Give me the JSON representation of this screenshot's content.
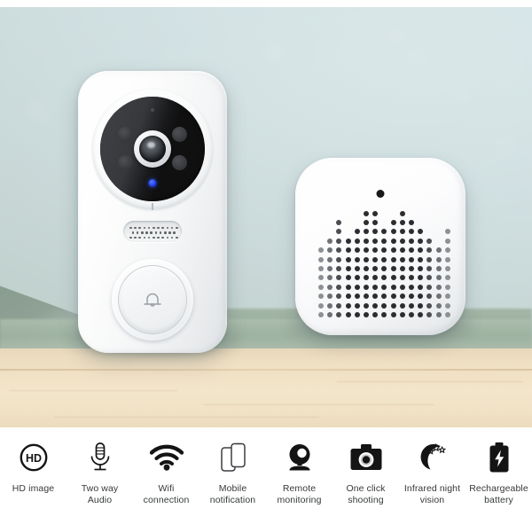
{
  "product": {
    "scene": {
      "wall_color": "#d3e1e4",
      "wall_shadow_color": "#8b9d90",
      "table_color": "#f1e2c6",
      "table_green_band": "#9fb3a1"
    },
    "doorbell": {
      "name": "Smart Video Doorbell",
      "body_color": "#ffffff",
      "camera_face_color": "#131314",
      "ir_led_count": 4,
      "status_led_color": "#2040e8",
      "button_icon": "bell-icon",
      "grille_rows": 3,
      "grille_cols": 11
    },
    "chime": {
      "name": "Wireless Chime Receiver",
      "body_color": "#ffffff",
      "led_color": "#18191b",
      "grille_pattern": "equalizer-dot-matrix",
      "grille_cols": 15,
      "grille_rows": 12,
      "grille_heights": [
        8,
        9,
        11,
        9,
        10,
        12,
        12,
        10,
        11,
        12,
        11,
        10,
        9,
        8,
        10
      ]
    }
  },
  "features": [
    {
      "icon": "hd-icon",
      "label": "HD image"
    },
    {
      "icon": "microphone-icon",
      "label": "Two way\nAudio"
    },
    {
      "icon": "wifi-icon",
      "label": "Wifi\nconnection"
    },
    {
      "icon": "mobile-notification-icon",
      "label": "Mobile\nnotification"
    },
    {
      "icon": "webcam-icon",
      "label": "Remote\nmonitoring"
    },
    {
      "icon": "camera-icon",
      "label": "One click\nshooting"
    },
    {
      "icon": "moon-stars-icon",
      "label": "Infrared night\nvision"
    },
    {
      "icon": "battery-bolt-icon",
      "label": "Rechargeable\nbattery"
    }
  ],
  "feature_text_color": "#35383a",
  "feature_icon_color": "#141414"
}
